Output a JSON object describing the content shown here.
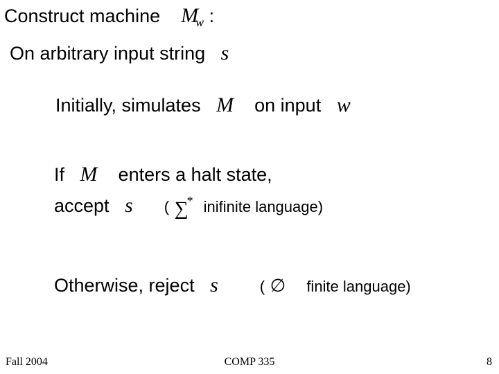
{
  "title": {
    "prefix": "Construct machine",
    "M": "M",
    "w": "w",
    "suffix": ":"
  },
  "line2": {
    "text": "On arbitrary input string",
    "s": "s"
  },
  "line3": {
    "prefix": "Initially, simulates",
    "M": "M",
    "mid": "on input",
    "w": "w"
  },
  "line4": {
    "if": "If",
    "M": "M",
    "rest": "enters a halt state,"
  },
  "line5": {
    "accept": "accept",
    "s": "s",
    "open": "(",
    "sigma": "∑",
    "star": "*",
    "tail": "inifinite language)"
  },
  "line6": {
    "prefix": "Otherwise, reject",
    "s": "s",
    "open": "(",
    "empty": "∅",
    "tail": "finite language)"
  },
  "footer": {
    "left": "Fall 2004",
    "center": "COMP 335",
    "right": "8"
  }
}
